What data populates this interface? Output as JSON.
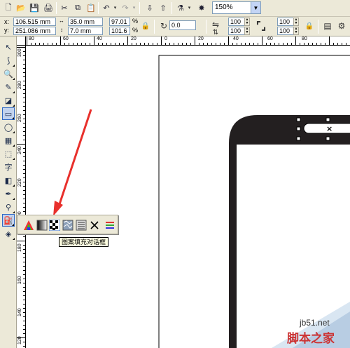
{
  "toolbar": {
    "zoom_value": "150%"
  },
  "propbar": {
    "x_label": "x:",
    "x_value": "106.515 mm",
    "y_label": "y:",
    "y_value": "251.086 mm",
    "width_value": "35.0 mm",
    "height_value": "7.0 mm",
    "scale_x": "97.01",
    "scale_y": "101.6",
    "percent_x": "%",
    "percent_y": "%",
    "rotation_value": "0.0",
    "corner_tl": "100",
    "corner_bl": "100",
    "corner_tr": "100",
    "corner_br": "100"
  },
  "rulers": {
    "horizontal_ticks": [
      "80",
      "60",
      "40",
      "20",
      "0",
      "20",
      "40",
      "60",
      "80"
    ],
    "vertical_ticks": [
      "300",
      "280",
      "260",
      "240",
      "220",
      "200",
      "180",
      "160",
      "140",
      "120"
    ]
  },
  "fill_flyout": {
    "tooltip": "图案填充对话框"
  },
  "watermark": {
    "site": "jb51.net",
    "name": "脚本之家"
  },
  "colors": {
    "ui_face": "#ece9d8",
    "arrow": "#e8302c",
    "shape_fill": "#231f20"
  }
}
